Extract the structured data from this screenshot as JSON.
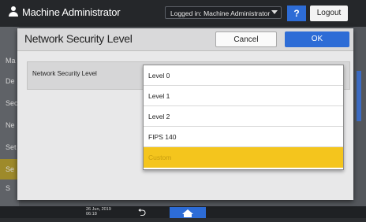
{
  "topbar": {
    "admin_name": "Machine Administrator",
    "logged_in": "Logged in: Machine Administrator",
    "help_label": "?",
    "logout_label": "Logout"
  },
  "background": {
    "side_labels": [
      "Ma",
      "De",
      "Sec",
      "Ne",
      "Set",
      "Se",
      "S"
    ]
  },
  "dialog": {
    "title": "Network Security Level",
    "cancel_label": "Cancel",
    "ok_label": "OK",
    "setting_label": "Network Security Level",
    "options": [
      "Level 0",
      "Level 1",
      "Level 2",
      "FIPS 140",
      "Custom"
    ],
    "selected_option": "Custom"
  },
  "bottombar": {
    "date": "26 Jun, 2019",
    "time": "06:18"
  },
  "colors": {
    "accent": "#2d6cd6",
    "selected_option_bg": "#f4c51d"
  }
}
